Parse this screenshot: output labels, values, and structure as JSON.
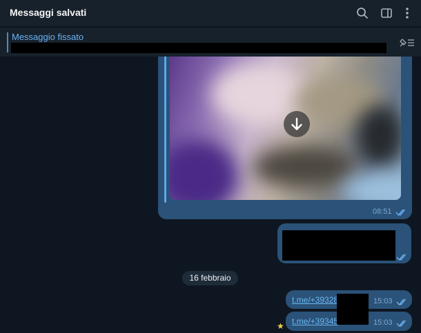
{
  "header": {
    "title": "Messaggi salvati",
    "icons": [
      "search-icon",
      "sidebar-toggle-icon",
      "more-vertical-icon"
    ]
  },
  "pinned": {
    "label": "Messaggio fissato",
    "action_icon": "unpin-list-icon"
  },
  "messages": {
    "media": {
      "time": "08:51",
      "status_icon": "double-check-icon",
      "action_icon": "download-icon"
    },
    "text": {
      "status_icon": "double-check-icon"
    },
    "date_separator": "16 febbraio",
    "links": [
      {
        "text": "t.me/+39328",
        "time": "15:03",
        "status_icon": "double-check-icon"
      },
      {
        "text": "t.me/+39345",
        "time": "15:03",
        "status_icon": "double-check-icon",
        "reaction_icon": "star-icon"
      }
    ]
  },
  "colors": {
    "background": "#0e1621",
    "header": "#17212b",
    "outgoing_bubble": "#2b5278",
    "accent": "#6ab2f2"
  }
}
